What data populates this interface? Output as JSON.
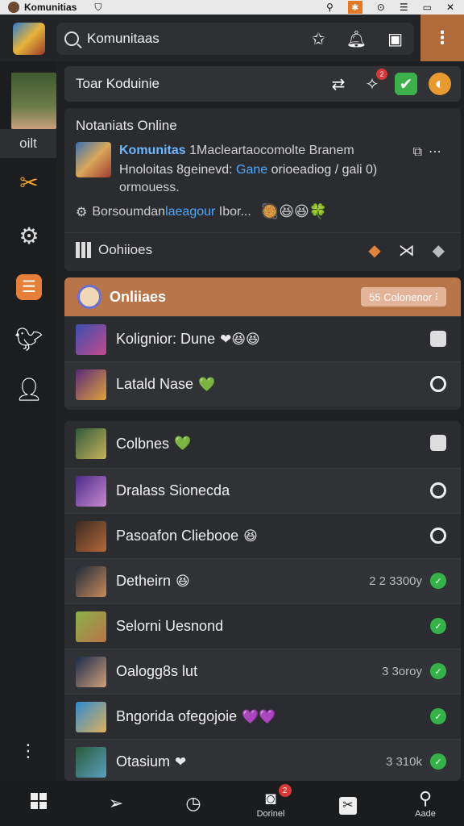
{
  "statusbar": {
    "title": "Komunitias",
    "shield_icon": "shield-icon",
    "icons": [
      "signal-icon",
      "app-icon",
      "location-icon",
      "menu-icon",
      "battery-icon",
      "close-icon"
    ]
  },
  "topbar": {
    "search_text": "Komunitaas",
    "icons": [
      "star-icon",
      "bell-icon",
      "bookmark-icon"
    ],
    "menu_icon": "more-vertical-icon"
  },
  "rail": {
    "label": "oilt",
    "items": [
      "tools-icon",
      "settings-icon",
      "list-icon",
      "twitter-icon",
      "user-icon"
    ],
    "more_icon": "more-icon"
  },
  "header_panel": {
    "title": "Toar Koduinie",
    "badge": "2"
  },
  "notifications": {
    "title": "Notaniats Online",
    "line1_highlight": "Komunitas",
    "line1_rest": "1Macleartaocomolte Branem",
    "line2_a": "Hnoloitas 8geinevd:",
    "line2_blue": "Gane",
    "line2_b": "orioeadiog / gali 0)",
    "line3": "ormouess.",
    "line4_a": "Borsoumdan",
    "line4_blue": "laeagour",
    "line4_b": "Ibor...",
    "line4_emojis": "🥘😆😆🍀",
    "row5_label": "Oohiioes"
  },
  "online": {
    "title": "Onliiaes",
    "pill": "55 Colonenor",
    "rows": [
      {
        "name": "Kolignior: Dune",
        "emo": "❤😆😆",
        "icon": "square"
      },
      {
        "name": "Latald Nase",
        "emo": "💚",
        "icon": "circle"
      }
    ]
  },
  "list": {
    "rows": [
      {
        "name": "Colbnes",
        "emo": "💚",
        "meta": "",
        "icon": "square"
      },
      {
        "name": "Dralass Sionecda",
        "emo": "",
        "meta": "",
        "icon": "circle"
      },
      {
        "name": "Pasoafon Cliebooe",
        "emo": "😆",
        "meta": "",
        "icon": "circle"
      },
      {
        "name": "Detheirn",
        "emo": "😆",
        "meta": "2 2 3300y",
        "icon": "green"
      },
      {
        "name": "Selorni Uesnond",
        "emo": "",
        "meta": "",
        "icon": "green"
      },
      {
        "name": "Oalogg8s lut",
        "emo": "",
        "meta": "3 3oroy",
        "icon": "green"
      },
      {
        "name": "Bngorida ofegojoie",
        "emo": "💜💜",
        "meta": "",
        "icon": "green"
      },
      {
        "name": "Otasium",
        "emo": "❤",
        "meta": "3 310k",
        "icon": "green"
      }
    ]
  },
  "bottomnav": {
    "items": [
      {
        "icon": "windows-icon",
        "label": ""
      },
      {
        "icon": "send-icon",
        "label": ""
      },
      {
        "icon": "clock-icon",
        "label": ""
      },
      {
        "icon": "chat-icon",
        "label": "Dorinel",
        "badge": "2"
      },
      {
        "icon": "tools-icon",
        "label": ""
      },
      {
        "icon": "search-icon",
        "label": "Aade"
      }
    ]
  },
  "colors": {
    "accent": "#b8754a",
    "background": "#1f2022",
    "panel": "#2b2c30",
    "link": "#4fa8ff",
    "online_green": "#36b24a"
  }
}
